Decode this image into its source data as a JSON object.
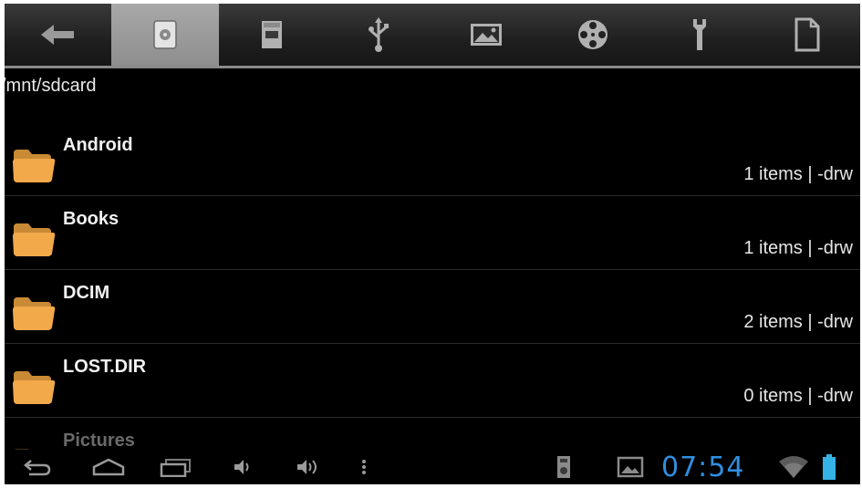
{
  "toolbar": {
    "tabs": [
      {
        "icon": "back-arrow-icon"
      },
      {
        "icon": "internal-storage-icon",
        "active": true
      },
      {
        "icon": "sd-card-icon"
      },
      {
        "icon": "usb-icon"
      },
      {
        "icon": "image-icon"
      },
      {
        "icon": "film-reel-icon"
      },
      {
        "icon": "wrench-icon"
      },
      {
        "icon": "document-icon"
      }
    ]
  },
  "path": "/mnt/sdcard",
  "files": [
    {
      "name": "Android",
      "meta": "1 items | -drw"
    },
    {
      "name": "Books",
      "meta": "1 items | -drw"
    },
    {
      "name": "DCIM",
      "meta": "2 items | -drw"
    },
    {
      "name": "LOST.DIR",
      "meta": "0 items | -drw"
    },
    {
      "name": "Pictures",
      "meta": ""
    }
  ],
  "status": {
    "time": "07:54"
  },
  "colors": {
    "folder": "#f2a94a",
    "clock": "#2f8fe0",
    "battery": "#35b3e6",
    "active_tab": "#9c9c9c"
  }
}
